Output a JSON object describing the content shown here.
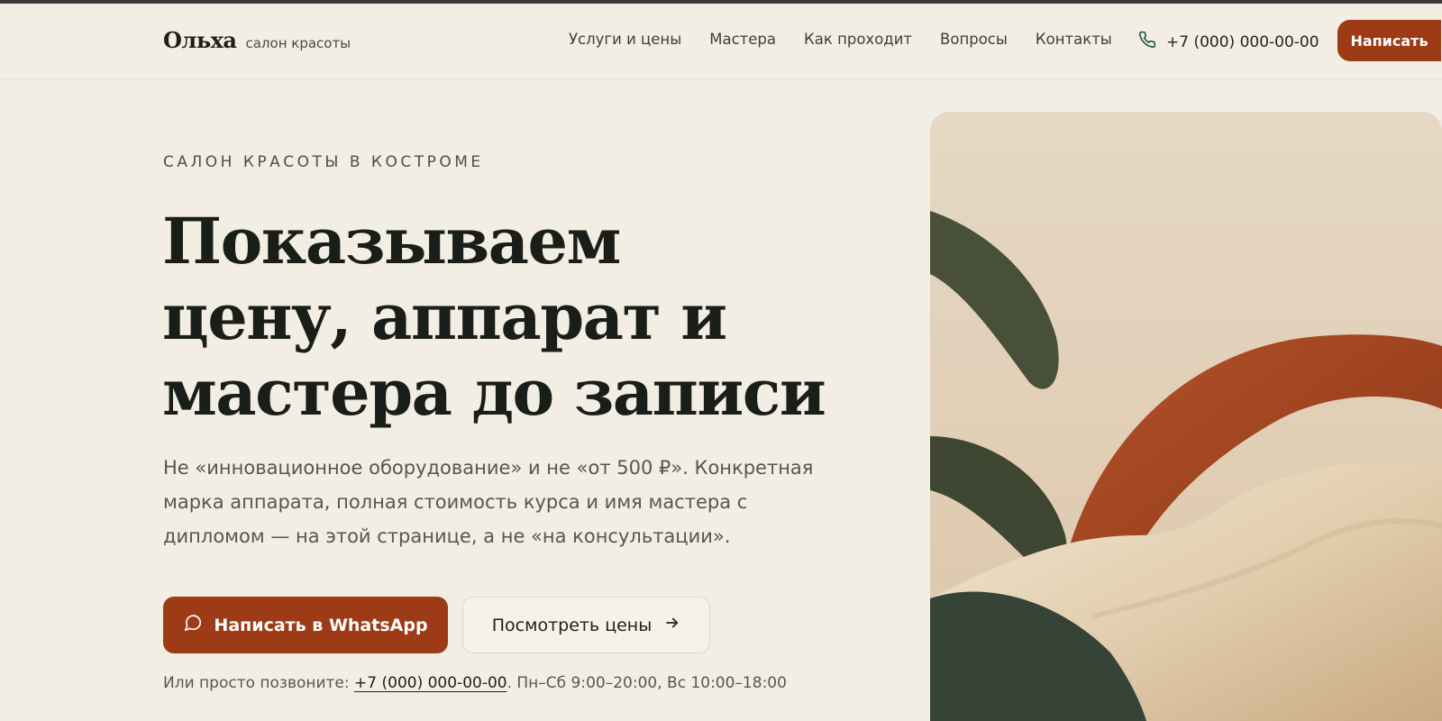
{
  "header": {
    "brand_name": "Ольха",
    "brand_tagline": "салон красоты",
    "nav": [
      "Услуги и цены",
      "Мастера",
      "Как проходит",
      "Вопросы",
      "Контакты"
    ],
    "phone": "+7 (000) 000-00-00",
    "cta_label": "Написать"
  },
  "hero": {
    "eyebrow": "САЛОН КРАСОТЫ В КОСТРОМЕ",
    "headline_lines": [
      "Показываем",
      "цену, аппарат и",
      "мастера до записи"
    ],
    "lead": "Не «инновационное оборудование» и не «от 500 ₽». Конкретная марка аппарата, полная стоимость курса и имя мастера с дипломом — на этой странице, а не «на консультации».",
    "primary_button": "Написать в WhatsApp",
    "secondary_button": "Посмотреть цены",
    "call_prefix": "Или просто позвоните: ",
    "call_phone": "+7 (000) 000-00-00",
    "call_hours": ". Пн–Сб 9:00–20:00, Вс 10:00–18:00"
  },
  "colors": {
    "accent": "#9c3b16",
    "background": "#f3eee4",
    "text": "#1d221c"
  },
  "icons": {
    "phone": "phone-icon",
    "whatsapp": "chat-bubble-icon",
    "arrow": "arrow-right-icon"
  }
}
